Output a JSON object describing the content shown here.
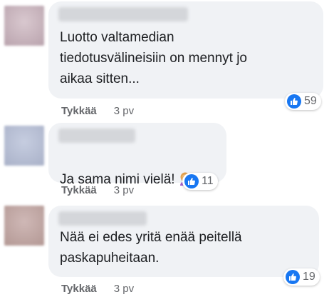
{
  "comments": [
    {
      "text": "Luotto valtamedian\ntiedotusvälineisiin on mennyt jo\naikaa sitten...",
      "reaction_count": "59",
      "like_label": "Tykkää",
      "time": "3 pv",
      "avatar_color": "#c9b7bf"
    },
    {
      "text": "Ja sama nimi vielä!",
      "emoji": "woman-facepalming-emoji",
      "reaction_count": "11",
      "like_label": "Tykkää",
      "time": "3 pv",
      "avatar_color": "#b7bfd1"
    },
    {
      "text": "Nää ei edes yritä enää peitellä\npaskapuheitaan.",
      "reaction_count": "19",
      "like_label": "Tykkää",
      "time": "3 pv",
      "avatar_color": "#c2aaa8"
    }
  ],
  "colors": {
    "bubble_bg": "#f0f2f5",
    "like_blue": "#1877f2",
    "meta_gray": "#65676b"
  }
}
